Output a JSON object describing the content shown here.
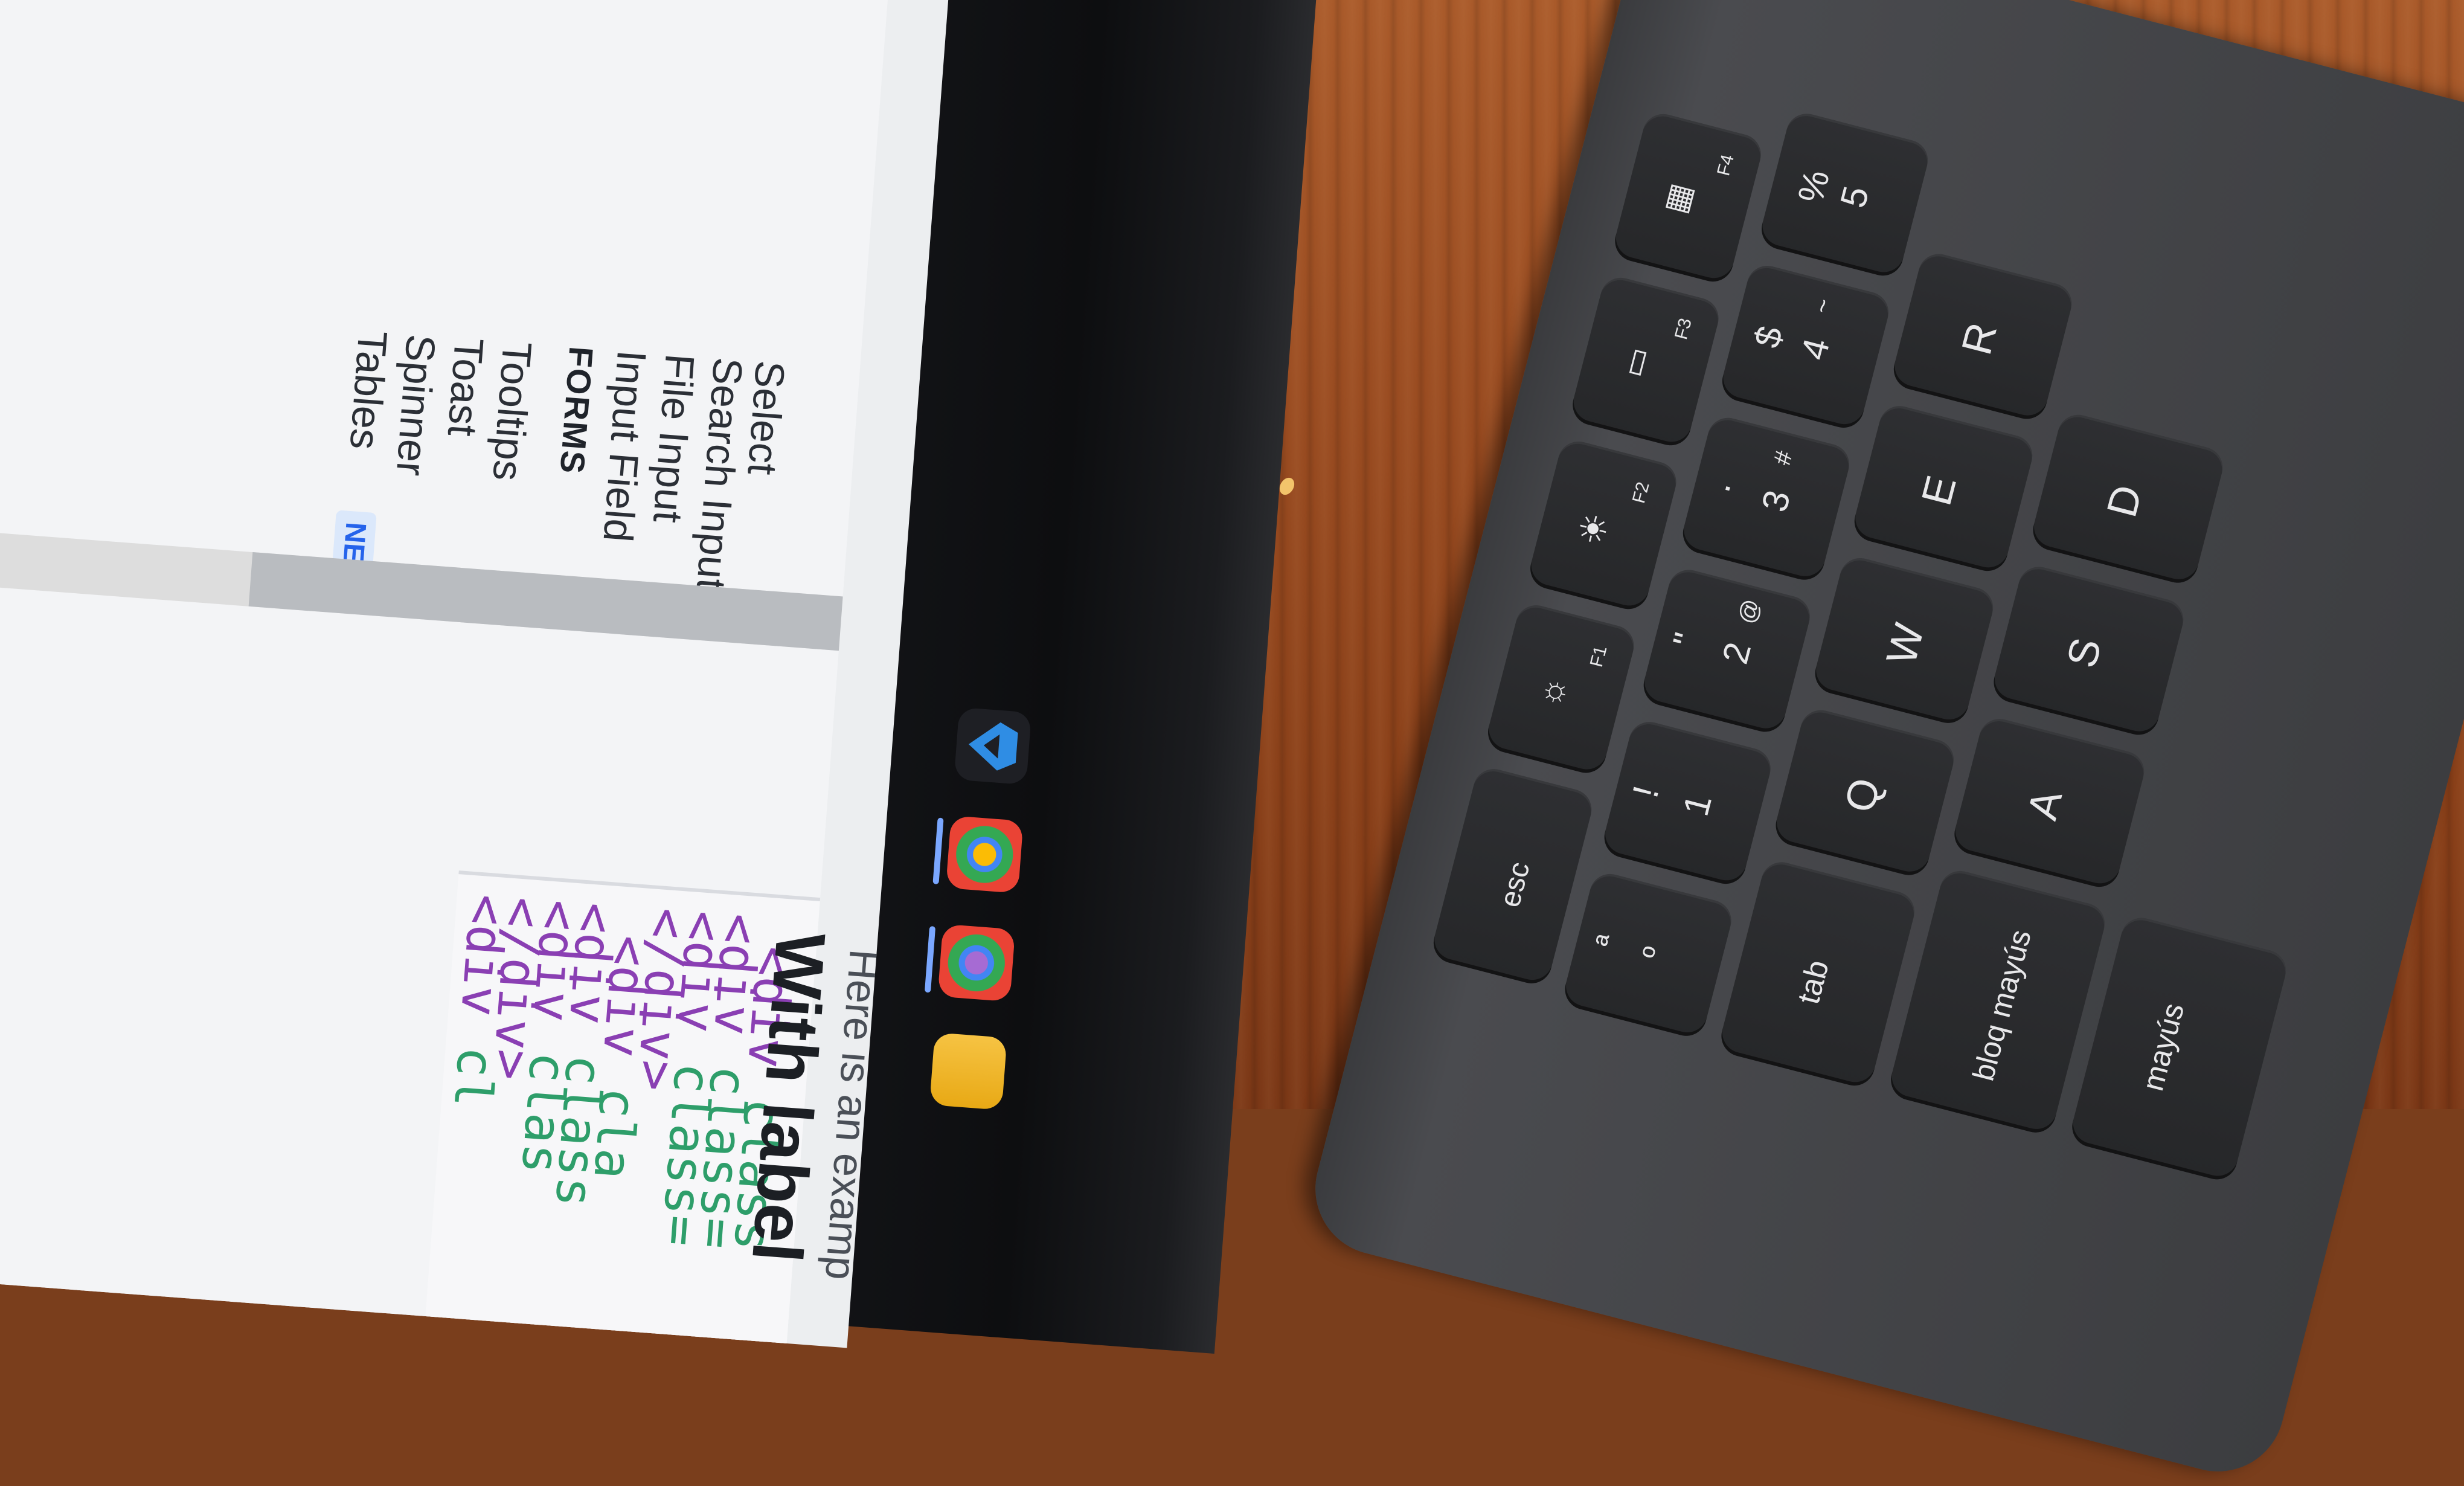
{
  "sidebar": {
    "items_top": [
      "Tables",
      "Spinner",
      "Toast",
      "Tooltips"
    ],
    "badge": "NEW",
    "section_heading": "FORMS",
    "form_items": [
      "Input Field",
      "File Input",
      "Search Input",
      "Select"
    ]
  },
  "code": {
    "lines": [
      {
        "tag": "<div",
        "text": " cl"
      },
      {
        "tag": "</div>",
        "text": ""
      },
      {
        "tag": "<div",
        "text": " clas"
      },
      {
        "tag": "<div",
        "text": " class"
      },
      {
        "tag": "<div",
        "text": " cla"
      },
      {
        "tag": "</div>",
        "text": ""
      },
      {
        "tag": "<div",
        "text": " class="
      },
      {
        "tag": "<div",
        "text": " class="
      },
      {
        "tag": "<div",
        "text": " class"
      }
    ]
  },
  "section": {
    "heading": "With label",
    "intro": "Here is an examp"
  },
  "taskbar": {
    "icons": [
      "folder-icon",
      "chrome-profile-icon",
      "chrome-profile-icon",
      "vscode-icon"
    ]
  },
  "keyboard": {
    "fn_row": [
      "esc",
      "F1",
      "F2",
      "F3",
      "F4"
    ],
    "number_row": [
      {
        "top": "ª",
        "main": "º",
        "alt": ""
      },
      {
        "top": "!",
        "main": "1",
        "alt": ""
      },
      {
        "top": "\"",
        "main": "2",
        "alt": "@"
      },
      {
        "top": "·",
        "main": "3",
        "alt": "#"
      },
      {
        "top": "$",
        "main": "4",
        "alt": "~"
      },
      {
        "top": "%",
        "main": "5",
        "alt": ""
      }
    ],
    "row_q": [
      "tab",
      "Q",
      "W",
      "E",
      "R"
    ],
    "row_a": [
      "bloq mayús",
      "A",
      "S",
      "D"
    ],
    "row_shift": [
      "mayús"
    ]
  }
}
